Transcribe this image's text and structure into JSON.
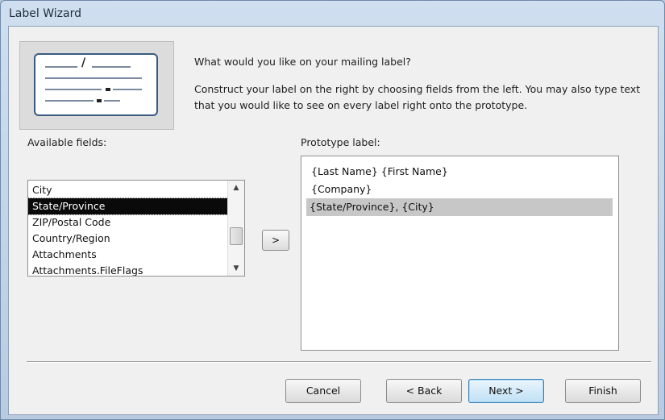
{
  "window": {
    "title": "Label Wizard"
  },
  "intro": {
    "question": "What would you like on your mailing label?",
    "instructions": "Construct your label on the right by choosing fields from the left. You may also type text that you would like to see on every label right onto the prototype."
  },
  "available_fields": {
    "label": "Available fields:",
    "items": [
      "City",
      "State/Province",
      "ZIP/Postal Code",
      "Country/Region",
      "Attachments",
      "Attachments.FileFlags"
    ],
    "selected": "State/Province"
  },
  "add_button": {
    "label": ">"
  },
  "prototype": {
    "label": "Prototype label:",
    "lines": [
      "{Last Name} {First Name}",
      "{Company}",
      "{State/Province}, {City}"
    ],
    "selected_line": "{State/Province}, {City}"
  },
  "buttons": {
    "cancel": "Cancel",
    "back": "< Back",
    "next": "Next >",
    "finish": "Finish"
  },
  "icons": {
    "scroll_up": "scroll-up-arrow-icon",
    "scroll_down": "scroll-down-arrow-icon",
    "illustration": "mailing-label-illustration-icon"
  }
}
